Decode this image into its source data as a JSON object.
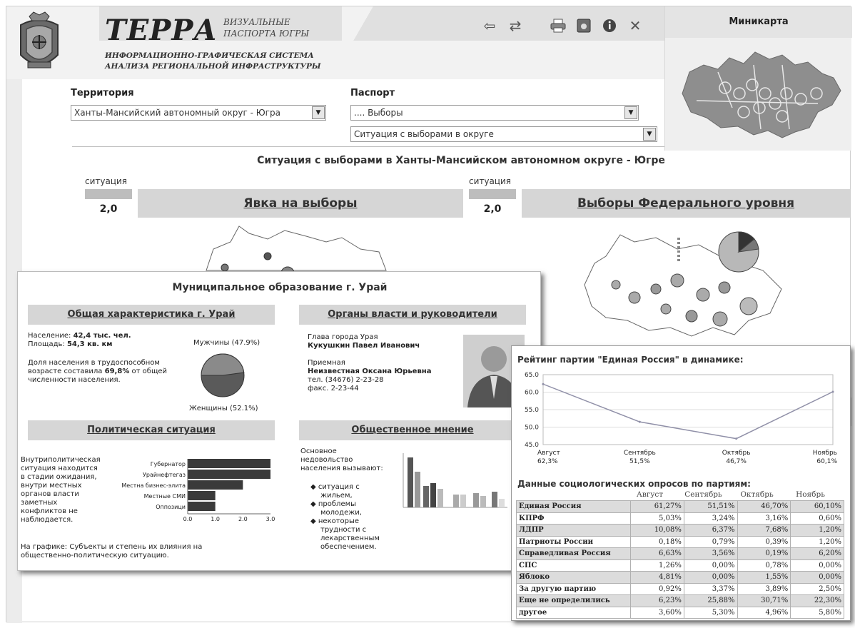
{
  "header": {
    "brand": "ТЕРРА",
    "sub_line1": "ВИЗУАЛЬНЫЕ",
    "sub_line2": "ПАСПОРТА ЮГРЫ",
    "desc_line1": "ИНФОРМАЦИОННО-ГРАФИЧЕСКАЯ СИСТЕМА",
    "desc_line2": "АНАЛИЗА РЕГИОНАЛЬНОЙ ИНФРАСТРУКТУРЫ"
  },
  "toolbar": {
    "back_icon": "back-arrow-icon",
    "refresh_icon": "refresh-icon",
    "print_icon": "printer-icon",
    "export_icon": "export-icon",
    "info_icon": "info-icon",
    "close_icon": "close-icon"
  },
  "minimap": {
    "title": "Миникарта"
  },
  "filters": {
    "territory_label": "Территория",
    "territory_value": "Ханты-Мансийский автономный округ - Югра",
    "passport_label": "Паспорт",
    "passport_value": ".... Выборы",
    "situation_value": "Ситуация с выборами в округе"
  },
  "main": {
    "title": "Ситуация с выборами в Ханты-Мансийском автономном округе - Югре",
    "block1": {
      "situation_label": "ситуация",
      "situation_value": "2,0",
      "heading": "Явка на выборы"
    },
    "block2": {
      "situation_label": "ситуация",
      "situation_value": "2,0",
      "heading": "Выборы Федерального уровня"
    }
  },
  "municipal": {
    "title": "Муниципальное образование г. Урай",
    "general_head": "Общая характеристика г. Урай",
    "population_label": "Население:",
    "population_value": "42,4 тыс. чел.",
    "area_label": "Площадь:",
    "area_value": "54,3 кв. км",
    "working_text_1": "Доля населения в трудоспособном",
    "working_text_2": "возрасте составила",
    "working_value": "69,8%",
    "working_text_3": "от общей",
    "working_text_4": "численности населения.",
    "pie_men": "Мужчины (47.9%)",
    "pie_women": "Женщины (52.1%)",
    "pie_men_share": 47.9,
    "authorities_head": "Органы власти и руководители",
    "head_title": "Глава города Урая",
    "head_name": "Кукушкин Павел Иванович",
    "reception_label": "Приемная",
    "reception_name": "Неизвестная Оксана Юрьевна",
    "phone": "тел. (34676) 2-23-28",
    "fax": "факс. 2-23-44",
    "political_head": "Политическая ситуация",
    "political_text": [
      "Внутриполитическая",
      "ситуация находится",
      "в стадии ожидания,",
      "внутри местных",
      "органов власти",
      "заметных",
      "конфликтов не",
      "наблюдается."
    ],
    "political_note_1": "На графике: Субъекты и степень их влияния на",
    "political_note_2": "общественно-политическую ситуацию.",
    "opinion_head": "Общественное мнение",
    "opinion_intro": [
      "Основное",
      "недовольство",
      "населения вызывают:"
    ],
    "opinion_items": [
      [
        "ситуация с",
        "жильем,"
      ],
      [
        "проблемы",
        "молодежи,"
      ],
      [
        "некоторые",
        "трудности с",
        "лекарственным",
        "обеспечением."
      ]
    ]
  },
  "rating": {
    "title": "Рейтинг партии \"Единая Россия\" в динамике:",
    "table_title": "Данные социологических опросов по партиям:",
    "months": [
      "Август",
      "Сентябрь",
      "Октябрь",
      "Ноябрь"
    ],
    "rows": [
      {
        "name": "Единая Россия",
        "values": [
          "61,27%",
          "51,51%",
          "46,70%",
          "60,10%"
        ]
      },
      {
        "name": "КПРФ",
        "values": [
          "5,03%",
          "3,24%",
          "3,16%",
          "0,60%"
        ]
      },
      {
        "name": "ЛДПР",
        "values": [
          "10,08%",
          "6,37%",
          "7,68%",
          "1,20%"
        ]
      },
      {
        "name": "Патриоты России",
        "values": [
          "0,18%",
          "0,79%",
          "0,39%",
          "1,20%"
        ]
      },
      {
        "name": "Справедливая Россия",
        "values": [
          "6,63%",
          "3,56%",
          "0,19%",
          "6,20%"
        ]
      },
      {
        "name": "СПС",
        "values": [
          "1,26%",
          "0,00%",
          "0,78%",
          "0,00%"
        ]
      },
      {
        "name": "Яблоко",
        "values": [
          "4,81%",
          "0,00%",
          "1,55%",
          "0,00%"
        ]
      },
      {
        "name": "За другую партию",
        "values": [
          "0,92%",
          "3,37%",
          "3,89%",
          "2,50%"
        ]
      },
      {
        "name": "Еще не определились",
        "values": [
          "6,23%",
          "25,88%",
          "30,71%",
          "22,30%"
        ]
      },
      {
        "name": "другое",
        "values": [
          "3,60%",
          "5,30%",
          "4,96%",
          "5,80%"
        ]
      }
    ]
  },
  "chart_data": [
    {
      "type": "line",
      "title": "Рейтинг партии \"Единая Россия\" в динамике:",
      "categories": [
        "Август",
        "Сентябрь",
        "Октябрь",
        "Ноябрь"
      ],
      "category_value_labels": [
        "62,3%",
        "51,5%",
        "46,7%",
        "60,1%"
      ],
      "values": [
        62.3,
        51.5,
        46.7,
        60.1
      ],
      "ylim": [
        45,
        65
      ],
      "yticks": [
        "45.0",
        "50.0",
        "55.0",
        "60.0",
        "65.0"
      ],
      "grid": true,
      "color": "#9090a8"
    },
    {
      "type": "bar",
      "orientation": "horizontal",
      "categories": [
        "Губернатор",
        "Урайнефтегаз",
        "Местна бизнес-элита",
        "Местные СМИ",
        "Оппозици"
      ],
      "values": [
        3.0,
        3.0,
        2.0,
        1.0,
        1.0
      ],
      "xlim": [
        0,
        3
      ],
      "xticks": [
        "0.0",
        "1.0",
        "2.0",
        "3.0"
      ],
      "color": "#3a3a3a"
    },
    {
      "type": "pie",
      "categories": [
        "Мужчины (47.9%)",
        "Женщины (52.1%)"
      ],
      "values": [
        47.9,
        52.1
      ]
    }
  ]
}
